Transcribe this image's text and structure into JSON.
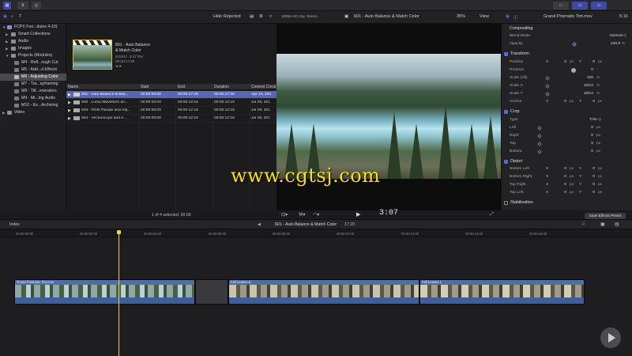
{
  "toolbar": {
    "buttons": [
      "▾",
      "⬇",
      "◎"
    ]
  },
  "browser_header": {
    "filter": "Hide Rejected",
    "filter_arrow": "◇"
  },
  "viewer_header": {
    "format": "1080p HD 24p, Stereo",
    "clip": "601 - Auto Balance & Match Color",
    "zoom": "35%",
    "view": "View"
  },
  "inspector_header": {
    "clip": "Grand Prismatic Tint.mov",
    "duration": "5:16"
  },
  "sidebar": {
    "library": "FCPX Fun...dules 4-10)",
    "items": [
      {
        "label": "Smart Collections",
        "indent": 1
      },
      {
        "label": "Audio",
        "indent": 1
      },
      {
        "label": "Images",
        "indent": 1
      },
      {
        "label": "Projects (Modules)",
        "indent": 1
      },
      {
        "label": "M4 - Refi...ough Cut",
        "indent": 2
      },
      {
        "label": "M5 - Add...d Effects",
        "indent": 2
      },
      {
        "label": "M6 - Adjusting Color",
        "indent": 2
      },
      {
        "label": "M7 - Tra...ayframing",
        "indent": 2
      },
      {
        "label": "M8 - Titl...enerators",
        "indent": 2
      },
      {
        "label": "M9 - Mi...lng Audio",
        "indent": 2
      },
      {
        "label": "M10 - Ex...Archiving",
        "indent": 2
      },
      {
        "label": "Video",
        "indent": 1
      }
    ]
  },
  "browser": {
    "selected_clip": {
      "title_line1": "601 - Auto Balance",
      "title_line2": "& Match Color",
      "date": "8/20/17, 3:47 PM",
      "duration": "00:00:17:29",
      "rating": "★★"
    },
    "columns": [
      "Name",
      "Start",
      "End",
      "Duration",
      "Content Creat"
    ],
    "rows": [
      {
        "name": "601 - Auto Balance & Mat...",
        "start": "00:00:00:00",
        "end": "00:00:17:29",
        "duration": "00:00:17:20",
        "created": "Apr 10, 201"
      },
      {
        "name": "602 - Luma Waveform an...",
        "start": "00:00:00:00",
        "end": "00:00:12:16",
        "duration": "00:00:12:16",
        "created": "Jul 29, 201"
      },
      {
        "name": "603 - RGB Parade and Adj...",
        "start": "00:00:00:00",
        "end": "00:00:12:16",
        "duration": "00:00:12:16",
        "created": "Jul 29, 201"
      },
      {
        "name": "604 - Vectorscope and A...",
        "start": "00:00:00:00",
        "end": "00:00:12:16",
        "duration": "00:00:12:16",
        "created": "Jul 29, 201"
      }
    ],
    "selection_count": "1 of 4 selected, 00:00"
  },
  "viewer": {
    "timecode": "3:07",
    "watermark": "www.cgtsj.com"
  },
  "inspector": {
    "compositing": {
      "title": "Compositing",
      "blend_mode_label": "Blend Mode",
      "blend_mode": "Normal ◇",
      "opacity_label": "Opacity",
      "opacity": "100.0",
      "opacity_unit": "%"
    },
    "transform": {
      "title": "Transform",
      "rows": [
        {
          "label": "Position",
          "x": "0",
          "y": "0",
          "unit": "px",
          "xlabel": "X",
          "ylabel": "Y"
        },
        {
          "label": "Rotation",
          "value": "0",
          "unit": "°"
        },
        {
          "label": "Scale (All)",
          "value": "100",
          "unit": "%"
        },
        {
          "label": "Scale X",
          "value": "100.0",
          "unit": "%"
        },
        {
          "label": "Scale Y",
          "value": "100.0",
          "unit": "%"
        },
        {
          "label": "Anchor",
          "x": "0",
          "y": "0",
          "unit": "px",
          "xlabel": "X",
          "ylabel": "Y"
        }
      ]
    },
    "crop": {
      "title": "Crop",
      "type_label": "Type",
      "type": "Trim ◇",
      "rows": [
        {
          "label": "Left",
          "value": "0",
          "unit": "px"
        },
        {
          "label": "Right",
          "value": "0",
          "unit": "px"
        },
        {
          "label": "Top",
          "value": "0",
          "unit": "px"
        },
        {
          "label": "Bottom",
          "value": "0",
          "unit": "px"
        }
      ]
    },
    "distort": {
      "title": "Distort",
      "rows": [
        {
          "label": "Bottom Left",
          "x": "0",
          "y": "0",
          "unit": "px",
          "xlabel": "X",
          "ylabel": "Y"
        },
        {
          "label": "Bottom Right",
          "x": "0",
          "y": "0",
          "unit": "px",
          "xlabel": "X",
          "ylabel": "Y"
        },
        {
          "label": "Top Right",
          "x": "0",
          "y": "0",
          "unit": "px",
          "xlabel": "X",
          "ylabel": "Y"
        },
        {
          "label": "Top Left",
          "x": "0",
          "y": "0",
          "unit": "px",
          "xlabel": "X",
          "ylabel": "Y"
        }
      ]
    },
    "stabilization": {
      "title": "Stabilization"
    },
    "save_effects": "Save Effects Preset"
  },
  "timeline": {
    "index_label": "Index",
    "project": "601 - Auto Balance & Match Color",
    "project_duration": "17:20",
    "ruler": [
      "00:00:00:00",
      "00:00:02:00",
      "00:00:04:00",
      "00:00:06:00",
      "00:00:08:00",
      "00:00:10:00",
      "00:00:12:00",
      "00:00:14:00",
      "00:00:16:00"
    ],
    "clips": [
      {
        "name": "Grand Prismatic Tint.mov"
      },
      {
        "name": "Fall Leaves 6"
      },
      {
        "name": "Fall Leaves 1"
      }
    ]
  },
  "colors": {
    "accent": "#5b64b5",
    "playhead": "#e8d84a",
    "clip_blue": "#4d6fa8",
    "watermark": "#ffe100"
  }
}
